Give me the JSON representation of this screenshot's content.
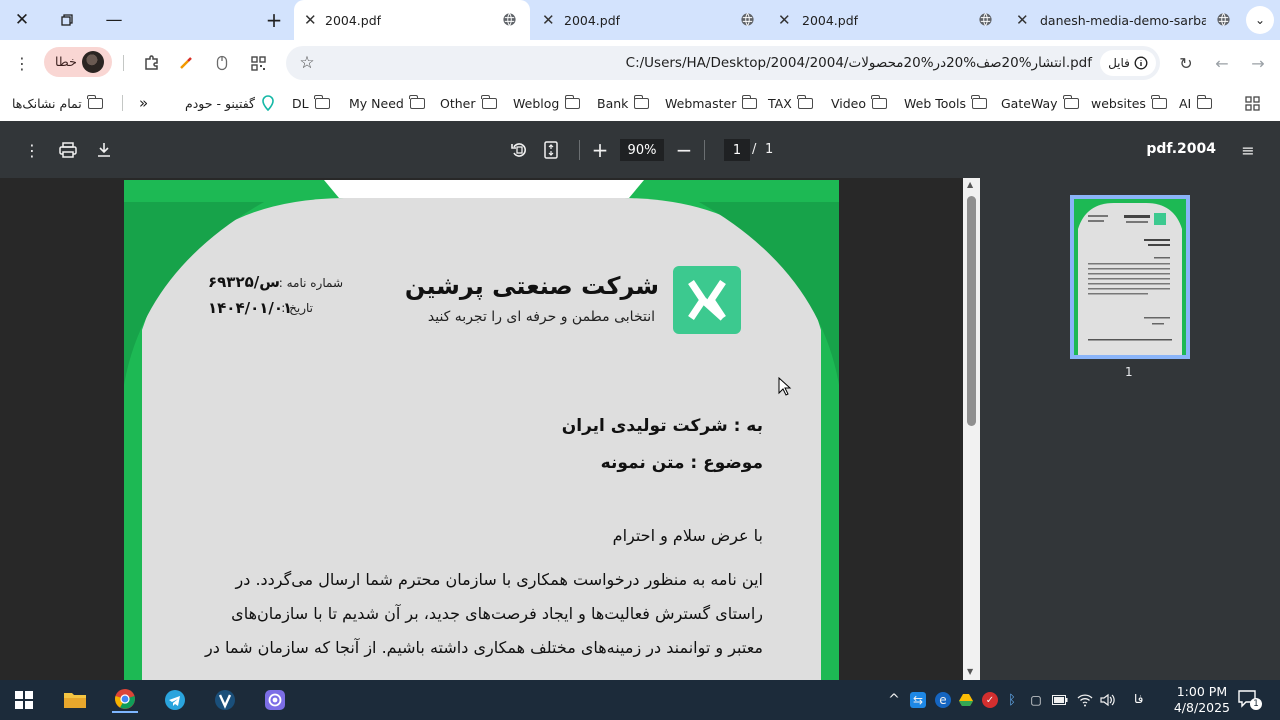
{
  "browser": {
    "tabs": [
      {
        "title": "2004.pdf",
        "active": true
      },
      {
        "title": "2004.pdf",
        "active": false
      },
      {
        "title": "2004.pdf",
        "active": false
      },
      {
        "title": "danesh-media-demo-sarbarg-s",
        "active": false
      }
    ],
    "address_bar": {
      "url": "C:/Users/HA/Desktop/2004/2004/انتشار%20صف%20در%20محصولات.pdf",
      "chip_label": "فایل"
    },
    "profile_label": "خطا",
    "bookmarks": [
      "AI",
      "websites",
      "GateWay",
      "Web Tools",
      "Video",
      "TAX",
      "Webmaster",
      "Bank",
      "Weblog",
      "Other",
      "My Need",
      "DL"
    ],
    "bookmark_special": "گفتینو - حودم",
    "all_bookmarks_label": "تمام نشانک‌ها"
  },
  "pdf_viewer": {
    "title": "pdf.2004",
    "zoom": "90%",
    "page_current": "1",
    "page_separator": "/",
    "page_total": "1",
    "thumbnail_page_number": "1"
  },
  "letter": {
    "company_name": "شرکت صنعتی پرشین",
    "tagline": "انتخابی مطمن و حرفه ای را تجربه کنید",
    "letter_number_label": "شماره نامه :",
    "letter_number_value": "س/۶۹۳۲۵",
    "date_label": "تاریخ :",
    "date_value": "۱۴۰۴/۰۱/۰۱",
    "to_line": "به : شرکت تولیدی ایران",
    "subject_line": "موضوع : متن نمونه",
    "greeting": "با عرض سلام و احترام",
    "body_lines": [
      "این نامه به منظور درخواست همکاری با سازمان محترم شما ارسال می‌گردد. در",
      "راستای گسترش فعالیت‌ها و ایجاد فرصت‌های جدید، بر آن شدیم تا با سازمان‌های",
      "معتبر و توانمند در زمینه‌های مختلف همکاری داشته باشیم. از آنجا که سازمان شما در"
    ],
    "accent_color": "#1db954"
  },
  "taskbar": {
    "time": "1:00 PM",
    "date": "4/8/2025",
    "language": "فا",
    "notification_count": "1"
  }
}
